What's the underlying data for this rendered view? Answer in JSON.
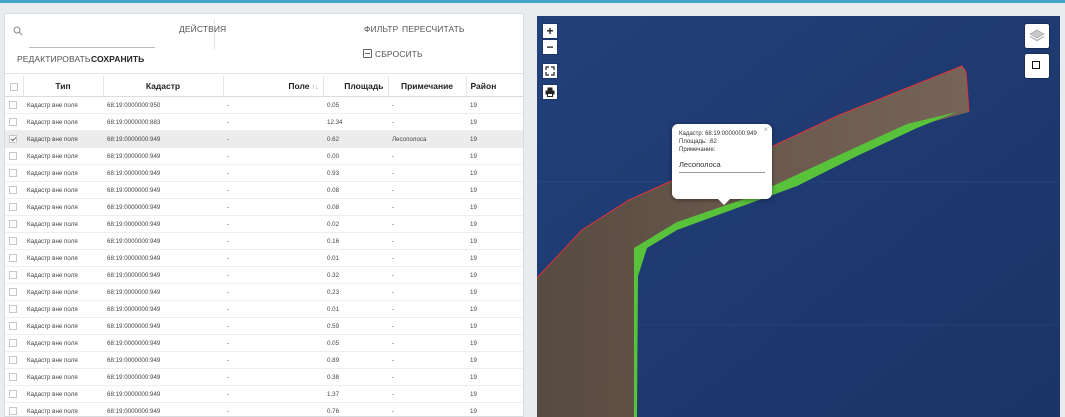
{
  "toolbar": {
    "search_placeholder": "",
    "actions_label": "ДЕЙСТВИЯ",
    "filter_label": "ФИЛЬТР",
    "recalc_label": "ПЕРЕСЧИТАТЬ",
    "edit_label": "РЕДАКТИРОВАТЬ",
    "save_label": "СОХРАНИТЬ",
    "reset_label": "СБРОСИТЬ"
  },
  "table": {
    "headers": {
      "type": "Тип",
      "cadastre": "Кадастр",
      "field": "Поле",
      "field_sort": "↑↓",
      "area": "Площадь",
      "note": "Примечание",
      "district": "Район"
    },
    "rows": [
      {
        "type": "Кадастр вне поля",
        "cadastre": "68:19:0000000:950",
        "field": "-",
        "area": "0.05",
        "note": "-",
        "district": "19",
        "checked": false
      },
      {
        "type": "Кадастр вне поля",
        "cadastre": "68:19:0000000:883",
        "field": "-",
        "area": "12.34",
        "note": "-",
        "district": "19",
        "checked": false
      },
      {
        "type": "Кадастр вне поля",
        "cadastre": "68:19:0000000:949",
        "field": "-",
        "area": "0.62",
        "note": "Лесополоса",
        "district": "19",
        "checked": true
      },
      {
        "type": "Кадастр вне поля",
        "cadastre": "68:19:0000000:949",
        "field": "-",
        "area": "0.00",
        "note": "-",
        "district": "19",
        "checked": false
      },
      {
        "type": "Кадастр вне поля",
        "cadastre": "68:19:0000000:949",
        "field": "-",
        "area": "0.93",
        "note": "-",
        "district": "19",
        "checked": false
      },
      {
        "type": "Кадастр вне поля",
        "cadastre": "68:19:0000000:949",
        "field": "-",
        "area": "0.08",
        "note": "-",
        "district": "19",
        "checked": false
      },
      {
        "type": "Кадастр вне поля",
        "cadastre": "68:19:0000000:949",
        "field": "-",
        "area": "0.08",
        "note": "-",
        "district": "19",
        "checked": false
      },
      {
        "type": "Кадастр вне поля",
        "cadastre": "68:19:0000000:949",
        "field": "-",
        "area": "0.02",
        "note": "-",
        "district": "19",
        "checked": false
      },
      {
        "type": "Кадастр вне поля",
        "cadastre": "68:19:0000000:949",
        "field": "-",
        "area": "0.16",
        "note": "-",
        "district": "19",
        "checked": false
      },
      {
        "type": "Кадастр вне поля",
        "cadastre": "68:19:0000000:949",
        "field": "-",
        "area": "0.01",
        "note": "-",
        "district": "19",
        "checked": false
      },
      {
        "type": "Кадастр вне поля",
        "cadastre": "68:19:0000000:949",
        "field": "-",
        "area": "0.32",
        "note": "-",
        "district": "19",
        "checked": false
      },
      {
        "type": "Кадастр вне поля",
        "cadastre": "68:19:0000000:949",
        "field": "-",
        "area": "0.23",
        "note": "-",
        "district": "19",
        "checked": false
      },
      {
        "type": "Кадастр вне поля",
        "cadastre": "68:19:0000000:949",
        "field": "-",
        "area": "0.01",
        "note": "-",
        "district": "19",
        "checked": false
      },
      {
        "type": "Кадастр вне поля",
        "cadastre": "68:19:0000000:949",
        "field": "-",
        "area": "0.59",
        "note": "-",
        "district": "19",
        "checked": false
      },
      {
        "type": "Кадастр вне поля",
        "cadastre": "68:19:0000000:949",
        "field": "-",
        "area": "0.05",
        "note": "-",
        "district": "19",
        "checked": false
      },
      {
        "type": "Кадастр вне поля",
        "cadastre": "68:19:0000000:949",
        "field": "-",
        "area": "0.89",
        "note": "-",
        "district": "19",
        "checked": false
      },
      {
        "type": "Кадастр вне поля",
        "cadastre": "68:19:0000000:949",
        "field": "-",
        "area": "0.38",
        "note": "-",
        "district": "19",
        "checked": false
      },
      {
        "type": "Кадастр вне поля",
        "cadastre": "68:19:0000000:949",
        "field": "-",
        "area": "1.37",
        "note": "-",
        "district": "19",
        "checked": false
      },
      {
        "type": "Кадастр вне поля",
        "cadastre": "68:19:0000000:949",
        "field": "-",
        "area": "0.76",
        "note": "-",
        "district": "19",
        "checked": false
      }
    ]
  },
  "map": {
    "zoom_in_label": "+",
    "zoom_out_label": "−",
    "fullscreen_icon": "expand-icon",
    "print_icon": "printer-icon",
    "layers_icon": "layers-icon",
    "draw_icon": "square-icon",
    "popup": {
      "cadastre_line": "Кадастр: 68:19:0000000:949",
      "area_line": "Площадь: .62",
      "note_label": "Примечание:",
      "note_value": "Лесополоса",
      "close_label": "×"
    }
  },
  "colors": {
    "accent": "#42a7c9",
    "polygon_fill": "#58c23a",
    "boundary": "#e0343a",
    "water": "#1f3a6e"
  }
}
